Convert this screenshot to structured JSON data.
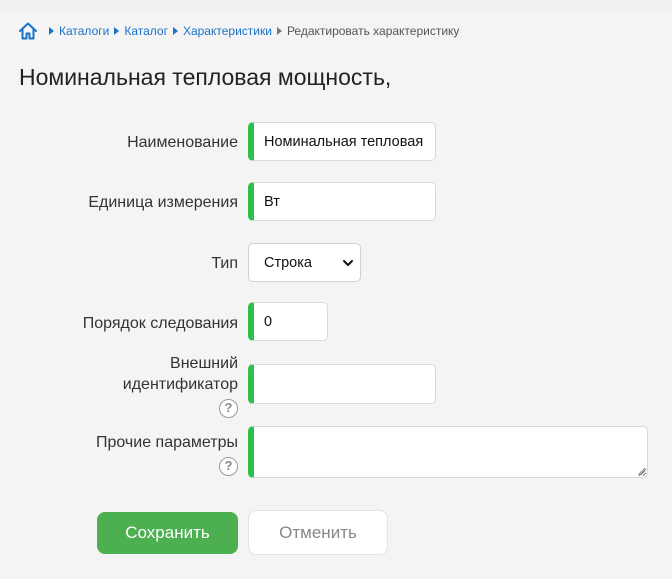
{
  "breadcrumb": {
    "items": [
      "Каталоги",
      "Каталог",
      "Характеристики"
    ],
    "current": "Редактировать характеристику"
  },
  "page": {
    "title": "Номинальная тепловая мощность,"
  },
  "form": {
    "name": {
      "label": "Наименование",
      "value": "Номинальная тепловая мощность,"
    },
    "unit": {
      "label": "Единица измерения",
      "value": "Вт"
    },
    "type": {
      "label": "Тип",
      "value": "Строка"
    },
    "order": {
      "label": "Порядок следования",
      "value": "0"
    },
    "external_id": {
      "label_line1": "Внешний",
      "label_line2": "идентификатор",
      "value": ""
    },
    "other_params": {
      "label": "Прочие параметры",
      "value": ""
    },
    "help_glyph": "?"
  },
  "actions": {
    "save_label": "Сохранить",
    "cancel_label": "Отменить"
  },
  "colors": {
    "accent_green": "#2fbf4c",
    "save_bg": "#4caf50",
    "link_blue": "#1a73c9"
  }
}
